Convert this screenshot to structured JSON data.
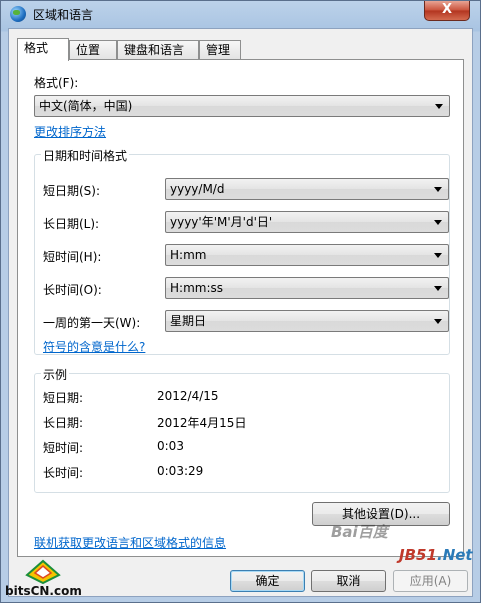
{
  "window": {
    "title": "区域和语言",
    "close_glyph": "X"
  },
  "tabs": [
    {
      "label": "格式",
      "active": true
    },
    {
      "label": "位置",
      "active": false
    },
    {
      "label": "键盘和语言",
      "active": false
    },
    {
      "label": "管理",
      "active": false
    }
  ],
  "format": {
    "label": "格式(F):",
    "value": "中文(简体，中国)",
    "change_sort_link": "更改排序方法"
  },
  "datetime": {
    "title": "日期和时间格式",
    "rows": [
      {
        "label": "短日期(S):",
        "value": "yyyy/M/d"
      },
      {
        "label": "长日期(L):",
        "value": "yyyy'年'M'月'd'日'"
      },
      {
        "label": "短时间(H):",
        "value": "H:mm"
      },
      {
        "label": "长时间(O):",
        "value": "H:mm:ss"
      },
      {
        "label": "一周的第一天(W):",
        "value": "星期日"
      }
    ],
    "meaning_link": "符号的含意是什么?"
  },
  "examples": {
    "title": "示例",
    "rows": [
      {
        "label": "短日期:",
        "value": "2012/4/15"
      },
      {
        "label": "长日期:",
        "value": "2012年4月15日"
      },
      {
        "label": "短时间:",
        "value": "0:03"
      },
      {
        "label": "长时间:",
        "value": "0:03:29"
      }
    ]
  },
  "other_settings_button": "其他设置(D)...",
  "online_link": "联机获取更改语言和区域格式的信息",
  "footer": {
    "ok": "确定",
    "cancel": "取消",
    "apply": "应用(A)"
  },
  "watermarks": {
    "left": "bitsCN.com",
    "right_jb": "JB51",
    "right_net": ".Net",
    "baidu": "Bai百度"
  }
}
